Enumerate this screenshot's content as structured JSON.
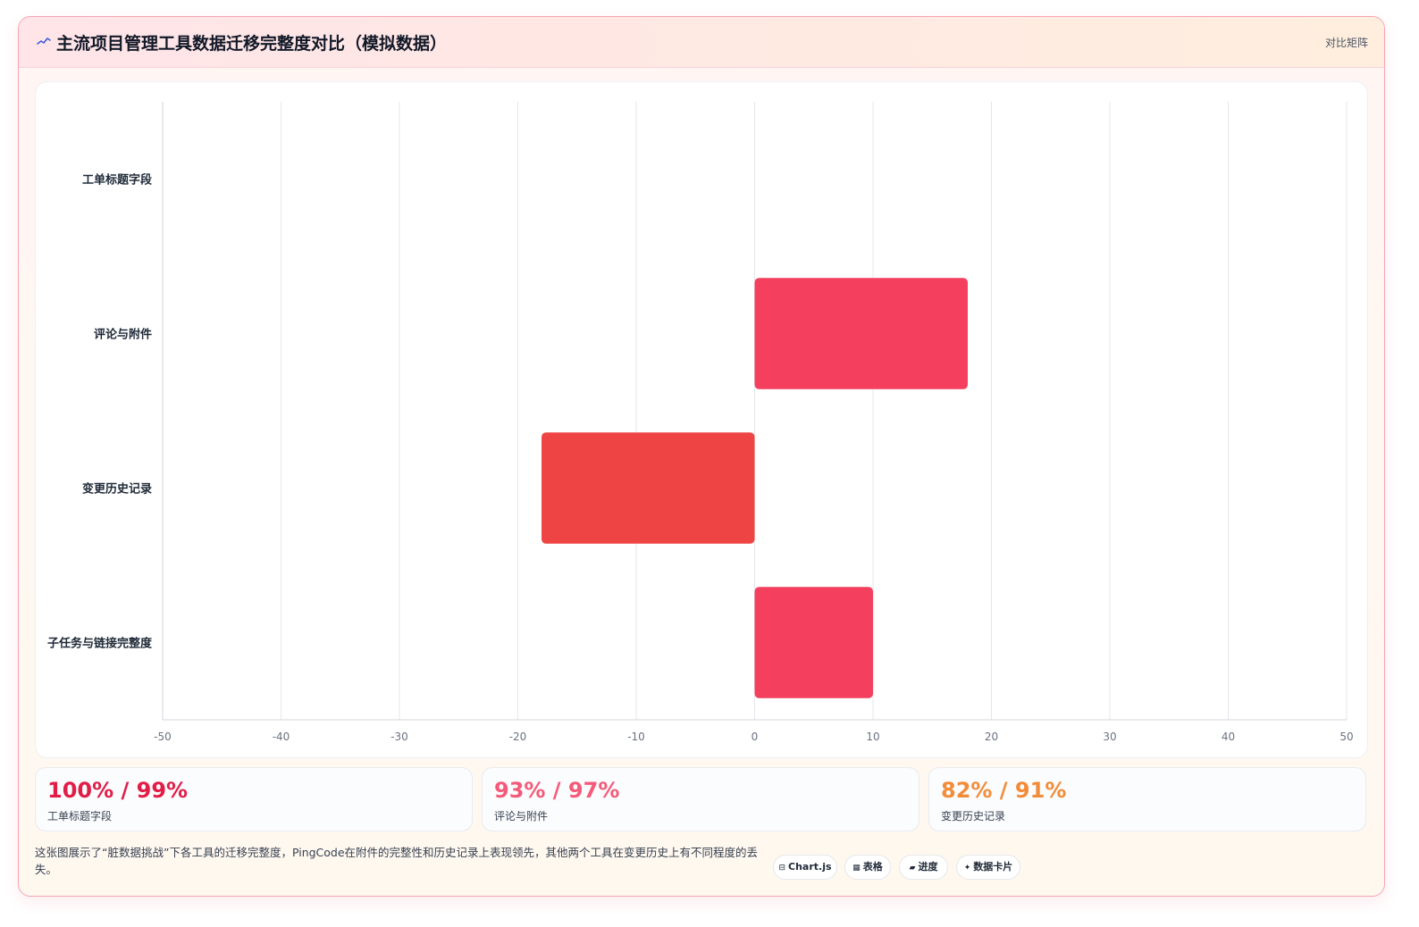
{
  "header": {
    "title": "主流项目管理工具数据迁移完整度对比（模拟数据）",
    "tag": "对比矩阵"
  },
  "chart_data": {
    "type": "bar",
    "orientation": "horizontal",
    "categories": [
      "工单标题字段",
      "评论与附件",
      "变更历史记录",
      "子任务与链接完整度"
    ],
    "values": [
      0,
      18,
      -18,
      10
    ],
    "xlim": [
      -50,
      50
    ],
    "xticks": [
      -50,
      -40,
      -30,
      -20,
      -10,
      0,
      10,
      20,
      30,
      40,
      50
    ],
    "grid": true,
    "legend": "none",
    "colors": {
      "positive": "#f43f5e",
      "negative": "#ef4444"
    }
  },
  "cards": [
    {
      "value": "100% / 99%",
      "label": "工单标题字段",
      "color": "#e11d48"
    },
    {
      "value": "93% / 97%",
      "label": "评论与附件",
      "color": "#f45b7a"
    },
    {
      "value": "82% / 91%",
      "label": "变更历史记录",
      "color": "#f28c38"
    }
  ],
  "footer": {
    "description": "这张图展示了“脏数据挑战”下各工具的迁移完整度，PingCode在附件的完整性和历史记录上表现领先，其他两个工具在变更历史上有不同程度的丢失。"
  },
  "chips": [
    {
      "icon": "⊟",
      "icon_name": "chart-icon",
      "label": "Chart.js"
    },
    {
      "icon": "▦",
      "icon_name": "table-icon",
      "label": "表格"
    },
    {
      "icon": "▰",
      "icon_name": "progress-icon",
      "label": "进度"
    },
    {
      "icon": "✦",
      "icon_name": "sparkle-icon",
      "label": "数据卡片"
    }
  ]
}
